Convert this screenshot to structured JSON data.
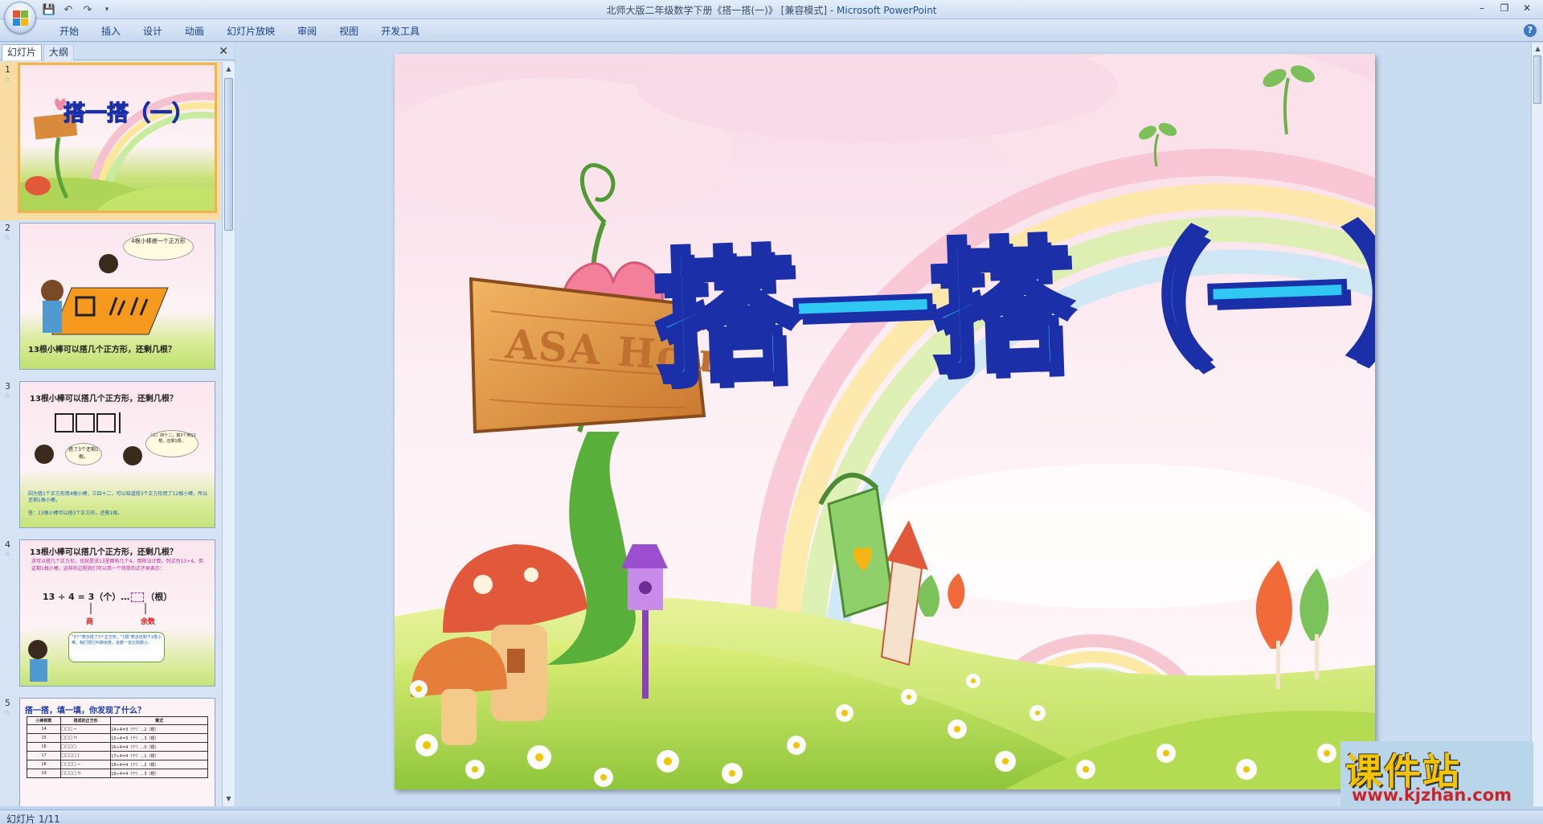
{
  "window": {
    "title_doc": "北师大版二年级数学下册《搭一搭(一)》 [兼容模式] - ",
    "title_app": "Microsoft PowerPoint"
  },
  "ribbon": {
    "tabs": [
      "开始",
      "插入",
      "设计",
      "动画",
      "幻灯片放映",
      "审阅",
      "视图",
      "开发工具"
    ]
  },
  "panel": {
    "tab_slides": "幻灯片",
    "tab_outline": "大纲"
  },
  "thumbnails": [
    {
      "num": "1",
      "title": "搭一搭（一）"
    },
    {
      "num": "2",
      "bubble": "4根小棒搭一个正方形",
      "caption": "13根小棒可以搭几个正方形，还剩几根？"
    },
    {
      "num": "3",
      "caption": "13根小棒可以搭几个正方形，还剩几根？",
      "bubble_left": "搭了3个还剩1根。",
      "bubble_right": "（三）四十二，搭3个用12根，还剩1根。",
      "line1": "因为搭1个正方形用4根小棒，三四十二，可以知道搭3个正方形用了12根小棒，所以还剩1根小棒。",
      "answer": "答：13根小棒可以搭3个正方形，还剩1根。"
    },
    {
      "num": "4",
      "caption": "13根小棒可以搭几个正方形，还剩几根？",
      "desc": "求可以搭几个正方形，也就是求13里面有几个4，用除法计算。列式为13÷4。但这剩1根小棒，这样的过程我们可以用一个简单的式子来表示：",
      "equation": "13 ÷ 4 = 3（个）…",
      "unit": "（根）",
      "label_quotient": "商",
      "label_remainder": "余数",
      "bubble": "\"3个\"表示搭了3个正方形，\"1根\"表示还剩下1根小棒，我们把它叫做余数，余数一定比除数小。"
    },
    {
      "num": "5",
      "title": "搭一搭，填一填，你发现了什么？",
      "headers": [
        "小棒根数",
        "搭成的正方形",
        "算式"
      ],
      "rows": [
        [
          "14",
          "□□□ ⌐",
          "14÷4=3（个）…2（根）"
        ],
        [
          "15",
          "□□□ ⊓",
          "15÷4=3（个）…3（根）"
        ],
        [
          "16",
          "□□□□",
          "16÷4=4（个）…0（根）"
        ],
        [
          "17",
          "□□□□ |",
          "17÷4=4（个）…1（根）"
        ],
        [
          "18",
          "□□□□ ⌐",
          "18÷4=4（个）…2（根）"
        ],
        [
          "19",
          "□□□□ ⊓",
          "19÷4=4（个）…3（根）"
        ]
      ]
    }
  ],
  "slide": {
    "title": "搭一搭（一）",
    "sign_text": "ASA Hou"
  },
  "status": {
    "text": "幻灯片 1/11"
  },
  "watermark": {
    "brand": "课件站",
    "url": "www.kjzhan.com"
  },
  "colors": {
    "title_fill": "#2ec8f2",
    "title_outline": "#1a2fa8",
    "accent": "#f2b34c"
  }
}
